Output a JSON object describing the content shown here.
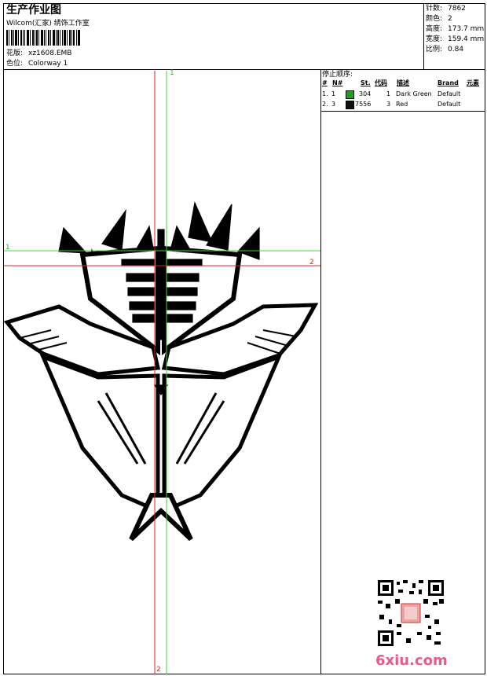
{
  "header": {
    "title": "生产作业图",
    "company": "Wilcom(汇家) 绣饰工作室",
    "design_label": "花版:",
    "design_file": "xz1608.EMB",
    "colorway_label": "色位:",
    "colorway": "Colorway 1"
  },
  "stats": [
    {
      "label": "针数:",
      "value": "7862"
    },
    {
      "label": "颜色:",
      "value": "2"
    },
    {
      "label": "高度:",
      "value": "173.7 mm"
    },
    {
      "label": "宽度:",
      "value": "159.4 mm"
    },
    {
      "label": "比例:",
      "value": "0.84"
    }
  ],
  "sequence": {
    "title": "停止顺序:",
    "headers": [
      "#",
      "N#",
      "St.",
      "代码",
      "描述",
      "Brand",
      "元素"
    ],
    "rows": [
      {
        "index": "1.",
        "needle": "1",
        "color": "#1f9e1f",
        "stitches": "304",
        "code": "1",
        "description": "Dark Green",
        "brand": "Default"
      },
      {
        "index": "2.",
        "needle": "3",
        "color": "#111111",
        "stitches": "7556",
        "code": "3",
        "description": "Red",
        "brand": "Default"
      }
    ]
  },
  "guides": {
    "green_vertical_label": "1",
    "green_horizontal_label": "1",
    "red_horizontal_label": "2",
    "red_vertical_label": "2",
    "green_color": "#33dd33",
    "red_color": "#dd2222"
  },
  "watermark": "6xiu.com"
}
